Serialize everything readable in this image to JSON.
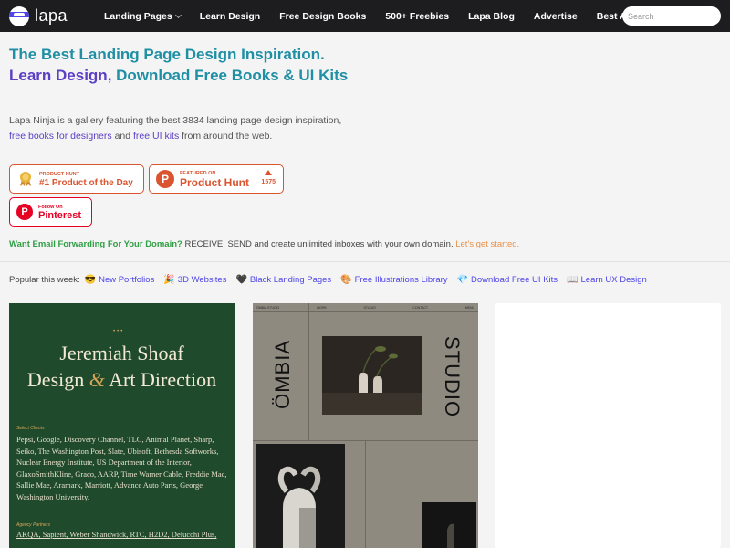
{
  "nav": {
    "logo_text": "lapa",
    "items": [
      {
        "label": "Landing Pages",
        "has_dropdown": true
      },
      {
        "label": "Learn Design"
      },
      {
        "label": "Free Design Books"
      },
      {
        "label": "500+ Freebies"
      },
      {
        "label": "Lapa Blog"
      },
      {
        "label": "Advertise"
      },
      {
        "label": "Best Animation Web"
      }
    ],
    "search_placeholder": "Search"
  },
  "hero": {
    "title_part1": "The Best Landing Page Design Inspiration.",
    "title_part2": "Learn Design, ",
    "title_part3": "Download Free Books & UI Kits",
    "desc_text1": "Lapa Ninja is a gallery featuring the best 3834 landing page design inspiration,",
    "desc_link1": "free books for designers",
    "desc_text2": " and ",
    "desc_link2": "free UI kits",
    "desc_text3": " from around the web."
  },
  "badges": {
    "pod_small": "Product Hunt",
    "pod_big": "#1 Product of the Day",
    "ph_small": "FEATURED ON",
    "ph_big": "Product Hunt",
    "ph_count": "1575",
    "pin_small": "Follow On",
    "pin_big": "Pinterest"
  },
  "promo": {
    "link": "Want Email Forwarding For Your Domain?",
    "text": " RECEIVE, SEND and create unlimited inboxes with your own domain. ",
    "cta": "Let's get started."
  },
  "popular": {
    "label": "Popular this week:",
    "items": [
      {
        "emoji": "😎",
        "label": "New Portfolios"
      },
      {
        "emoji": "🎉",
        "label": "3D Websites"
      },
      {
        "emoji": "🖤",
        "label": "Black Landing Pages"
      },
      {
        "emoji": "🎨",
        "label": "Free Illustrations Library"
      },
      {
        "emoji": "💎",
        "label": "Download Free UI Kits"
      },
      {
        "emoji": "📖",
        "label": "Learn UX Design"
      }
    ]
  },
  "cards": {
    "card1": {
      "title_line1": "Jeremiah Shoaf",
      "title_line2a": "Design ",
      "title_amp": "&",
      "title_line2b": " Art Direction",
      "clients_label": "Select Clients",
      "clients": "Pepsi, Google, Discovery Channel, TLC, Animal Planet, Sharp, Seiko, The Washington Post, Slate, Ubisoft, Bethesda Softworks, Nuclear Energy Institute, US Department of the Interior, GlaxoSmithKline, Graco, AARP, Time Warner Cable, Freddie Mac, Sallie Mae, Aramark, Marriott, Advance Auto Parts, George Washington University.",
      "agencies_label": "Agency Partners",
      "agencies": "AKQA, Sapient, Weber Shandwick, RTC, H2D2, Delucchi Plus,"
    },
    "card2": {
      "topbar": [
        "ÖMBIA STUDIO",
        "WORK",
        "STUDIO",
        "CONTACT",
        "MENU"
      ],
      "left_word": "ÖMBIA",
      "right_word": "STUDIO"
    }
  },
  "colors": {
    "nav_bg": "#1d1d1f",
    "title_purple": "#5b3fc4",
    "title_teal": "#1f8fa3",
    "producthunt": "#da552f",
    "pinterest": "#e60023",
    "promo_green": "#2f9e44",
    "promo_orange": "#e8914a",
    "card1_bg": "#1f4a2c"
  }
}
